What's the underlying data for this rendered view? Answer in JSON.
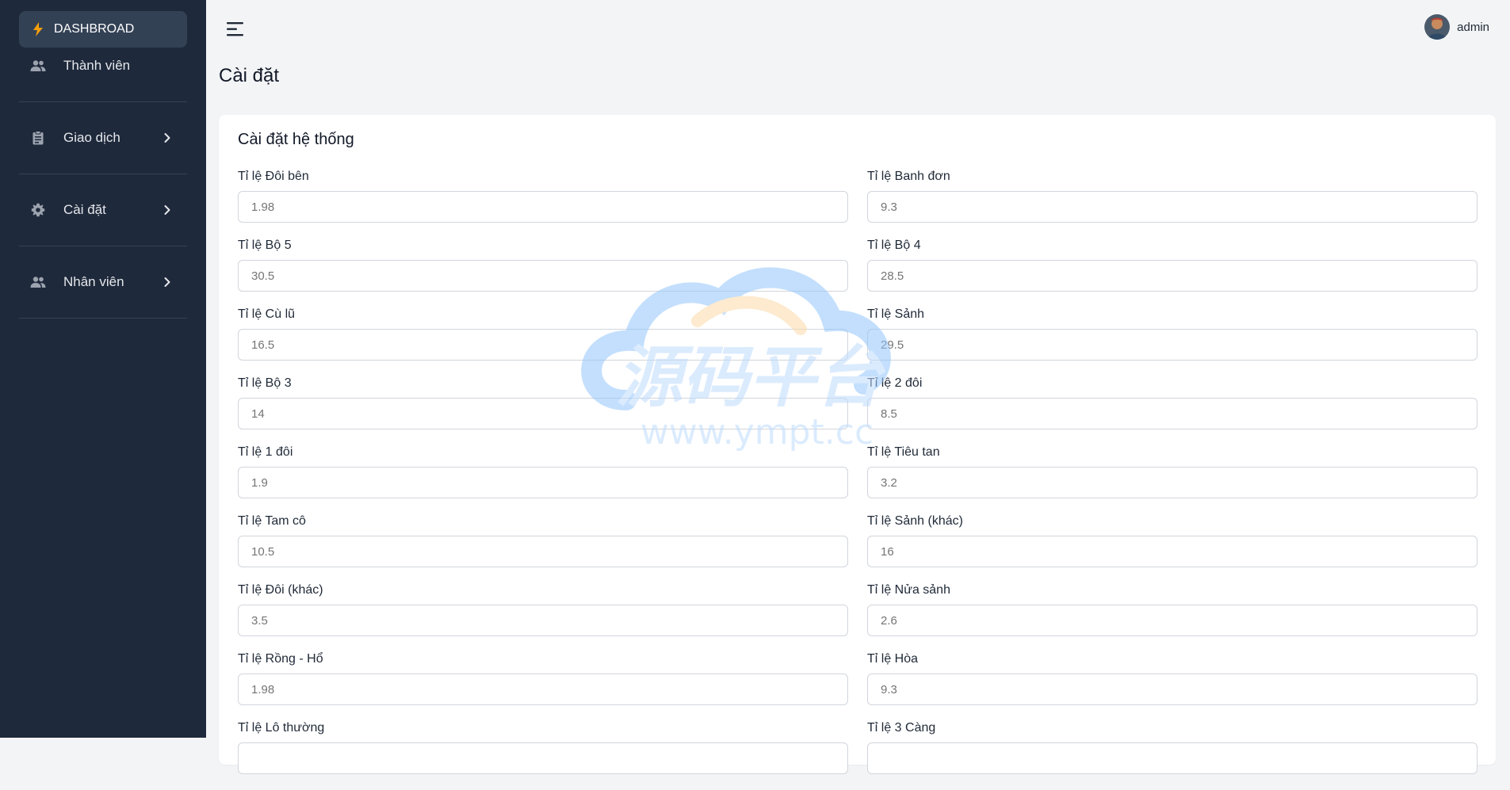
{
  "sidebar": {
    "items": [
      {
        "label": "DASHBROAD",
        "icon": "bolt-icon"
      },
      {
        "label": "Thành viên",
        "icon": "users-icon"
      },
      {
        "label": "Giao dịch",
        "icon": "clipboard-icon"
      },
      {
        "label": "Cài đặt",
        "icon": "gear-icon"
      },
      {
        "label": "Nhân viên",
        "icon": "users-icon"
      }
    ]
  },
  "header": {
    "user_name": "admin"
  },
  "page": {
    "title": "Cài đặt"
  },
  "card": {
    "title": "Cài đặt hệ thống",
    "fields": [
      {
        "label": "Tỉ lệ Đôi bên",
        "placeholder": "1.98"
      },
      {
        "label": "Tỉ lệ Banh đơn",
        "placeholder": "9.3"
      },
      {
        "label": "Tỉ lệ Bộ 5",
        "placeholder": "30.5"
      },
      {
        "label": "Tỉ lệ Bộ 4",
        "placeholder": "28.5"
      },
      {
        "label": "Tỉ lệ Cù lũ",
        "placeholder": "16.5"
      },
      {
        "label": "Tỉ lệ Sảnh",
        "placeholder": "29.5"
      },
      {
        "label": "Tỉ lệ Bộ 3",
        "placeholder": "14"
      },
      {
        "label": "Tỉ lệ 2 đôi",
        "placeholder": "8.5"
      },
      {
        "label": "Tỉ lệ 1 đôi",
        "placeholder": "1.9"
      },
      {
        "label": "Tỉ lệ Tiêu tan",
        "placeholder": "3.2"
      },
      {
        "label": "Tỉ lệ Tam cô",
        "placeholder": "10.5"
      },
      {
        "label": "Tỉ lệ Sảnh (khác)",
        "placeholder": "16"
      },
      {
        "label": "Tỉ lệ Đôi (khác)",
        "placeholder": "3.5"
      },
      {
        "label": "Tỉ lệ Nửa sảnh",
        "placeholder": "2.6"
      },
      {
        "label": "Tỉ lệ Rồng - Hổ",
        "placeholder": "1.98"
      },
      {
        "label": "Tỉ lệ Hòa",
        "placeholder": "9.3"
      },
      {
        "label": "Tỉ lệ Lô thường",
        "placeholder": ""
      },
      {
        "label": "Tỉ lệ 3 Càng",
        "placeholder": ""
      }
    ]
  },
  "watermark": {
    "text": "源码平台",
    "url": "www.ympt.cc"
  },
  "colors": {
    "sidebar_bg": "#1e293b",
    "active_bg": "#334155",
    "accent_bolt": "#f59e0b"
  }
}
